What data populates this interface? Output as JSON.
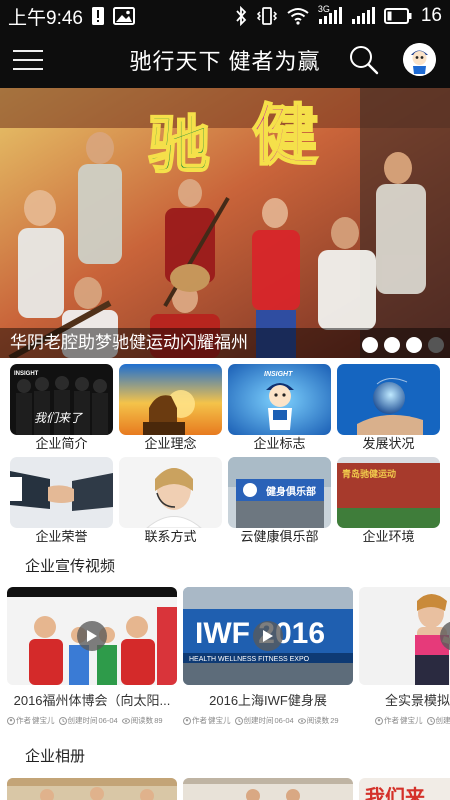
{
  "status_bar": {
    "time": "上午9:46",
    "signal_3g": "3G",
    "battery_level": "16"
  },
  "app_bar": {
    "title": "驰行天下 健者为赢"
  },
  "banner": {
    "caption": "华阴老腔助梦驰健运动闪耀福州",
    "headline_chars": [
      "驰",
      "健"
    ],
    "page_count": 4,
    "active_page": 3
  },
  "grid": [
    {
      "label": "企业简介",
      "image_text": "我们来了",
      "image_tag": "INSIGHT"
    },
    {
      "label": "企业理念"
    },
    {
      "label": "企业标志",
      "image_tag": "INSIGHT"
    },
    {
      "label": "发展状况"
    },
    {
      "label": "企业荣誉"
    },
    {
      "label": "联系方式"
    },
    {
      "label": "云健康俱乐部",
      "image_text": "健身俱乐部"
    },
    {
      "label": "企业环境",
      "image_text": "青岛驰健运动"
    }
  ],
  "videos_section": {
    "title": "企业宣传视频",
    "items": [
      {
        "title": "2016福州体博会（向太阳...",
        "author_label": "作者",
        "author": "健宝儿",
        "created_label": "创建时间",
        "created": "06-04",
        "views_label": "阅读数",
        "views": "89"
      },
      {
        "title": "2016上海IWF健身展",
        "author_label": "作者",
        "author": "健宝儿",
        "created_label": "创建时间",
        "created": "06-04",
        "views_label": "阅读数",
        "views": "29",
        "image_text": "IWF 2016",
        "image_sub": "HEALTH WELLNESS FITNESS EXPO"
      },
      {
        "title": "全实景模拟自",
        "author_label": "作者",
        "author": "健宝儿",
        "created_label": "创建时间"
      }
    ]
  },
  "album_section": {
    "title": "企业相册",
    "third_image_text": "我们来"
  },
  "colors": {
    "bar_background": "#0d0d0d",
    "background": "#ffffff",
    "text": "#222222"
  }
}
